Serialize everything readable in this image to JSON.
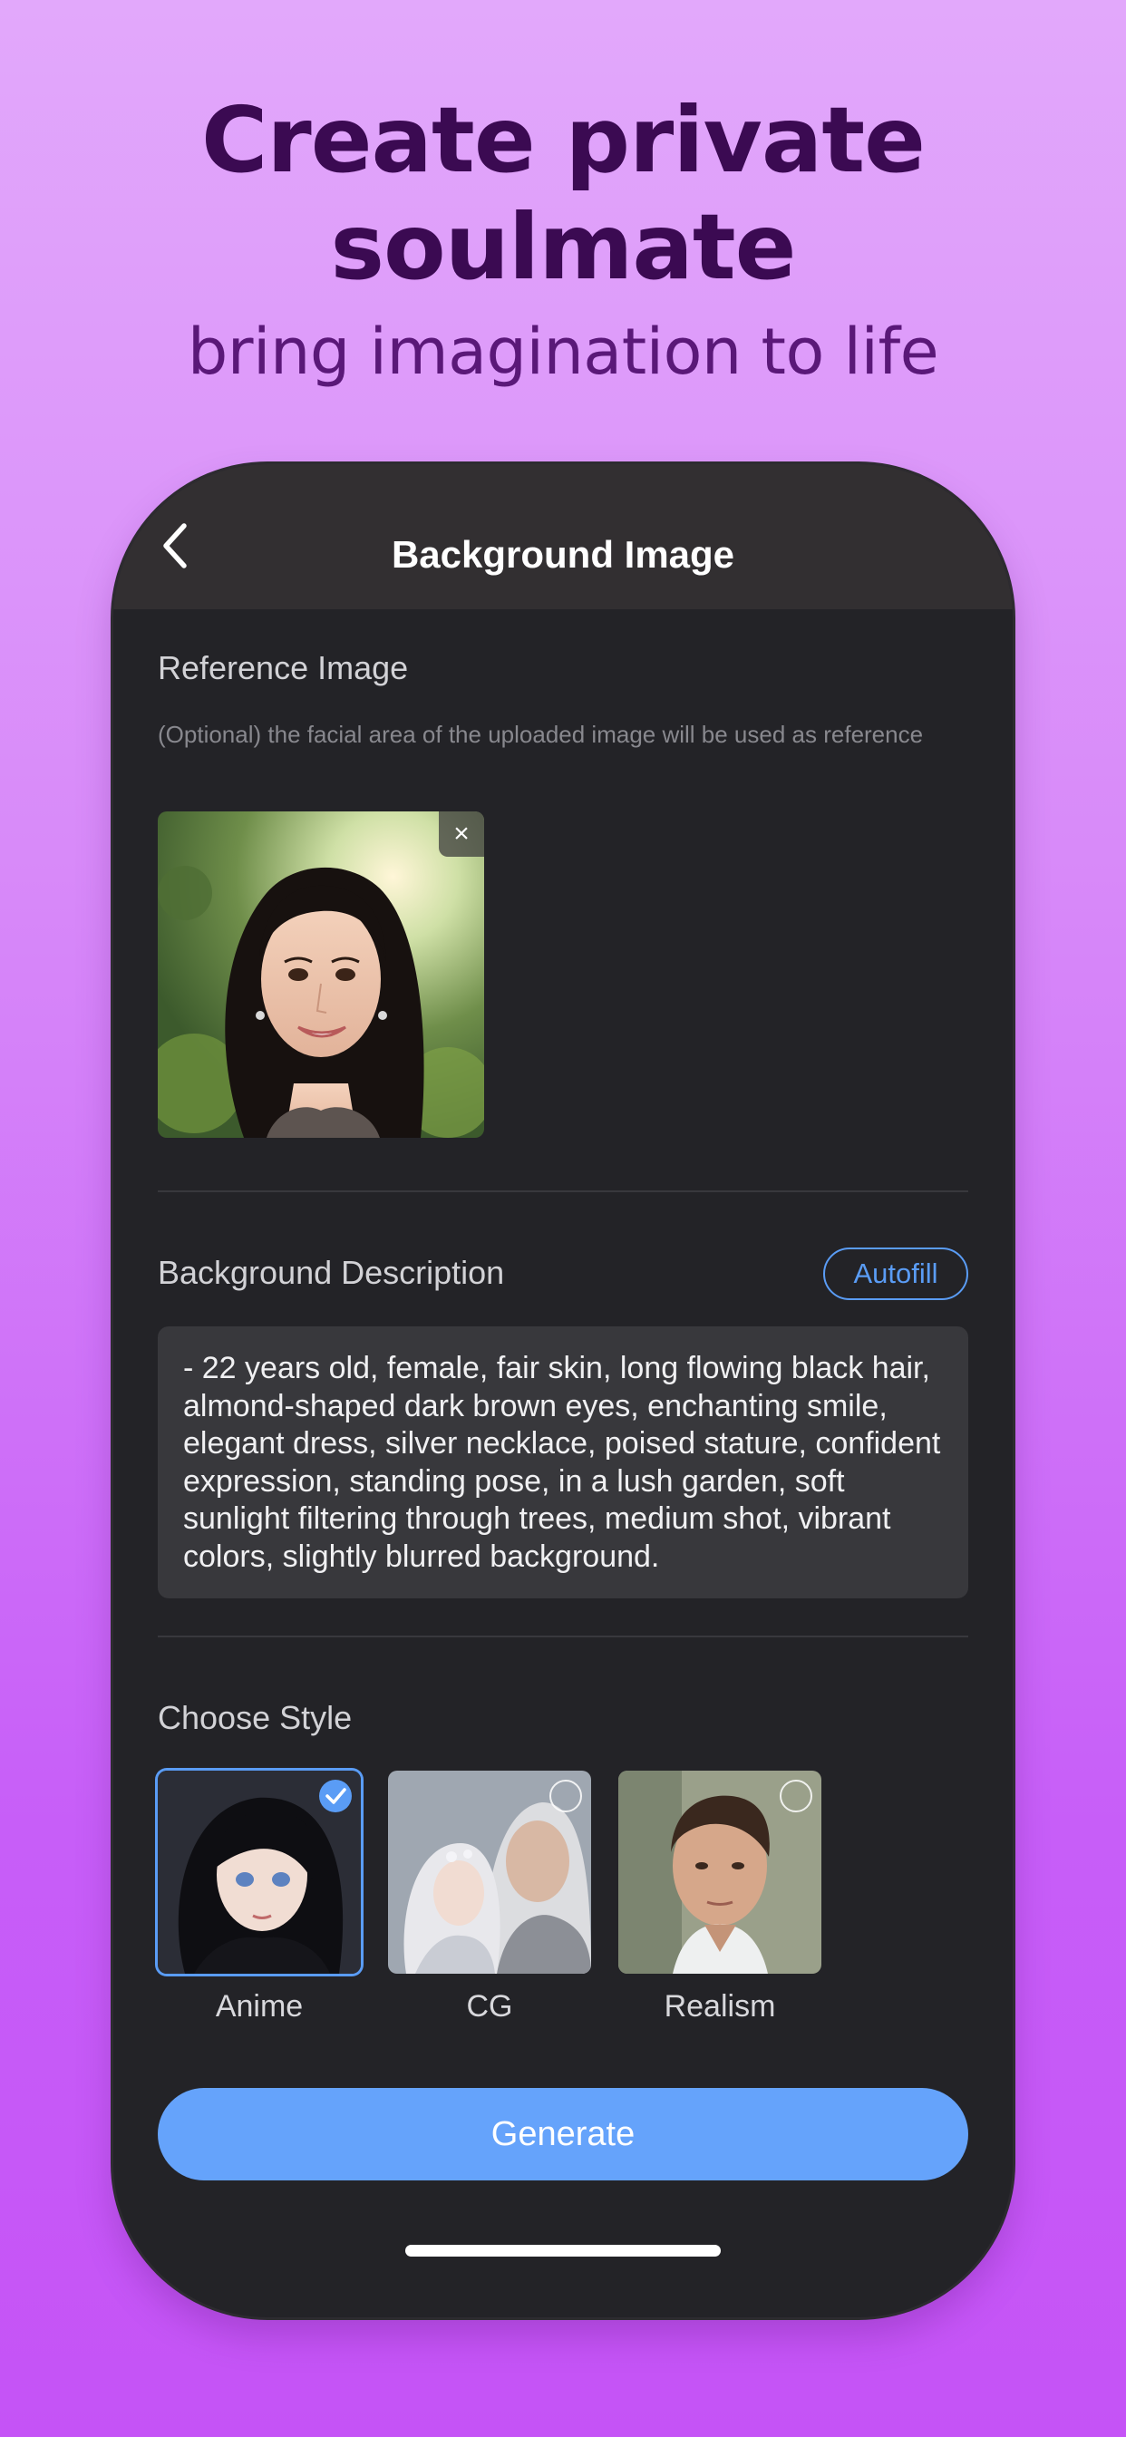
{
  "promo": {
    "title_line1": "Create private",
    "title_line2": "soulmate",
    "subtitle": "bring imagination to life"
  },
  "header": {
    "title": "Background Image",
    "back_icon": "chevron-left-icon"
  },
  "reference": {
    "label": "Reference Image",
    "hint": "(Optional) the facial area of the uploaded image will be used as reference",
    "remove_glyph": "×"
  },
  "background": {
    "label": "Background Description",
    "autofill_label": "Autofill",
    "description": "- 22 years old, female, fair skin, long flowing black hair, almond-shaped dark brown eyes, enchanting smile, elegant dress, silver necklace, poised stature, confident expression, standing pose, in a lush garden, soft sunlight filtering through trees, medium shot, vibrant colors, slightly blurred background."
  },
  "style": {
    "label": "Choose Style",
    "options": [
      {
        "label": "Anime",
        "selected": true
      },
      {
        "label": "CG",
        "selected": false
      },
      {
        "label": "Realism",
        "selected": false
      }
    ]
  },
  "actions": {
    "generate_label": "Generate"
  },
  "colors": {
    "accent": "#65a3fb",
    "screen_bg": "#232327",
    "header_bg": "#322f31",
    "title_purple": "#3b0a52"
  }
}
